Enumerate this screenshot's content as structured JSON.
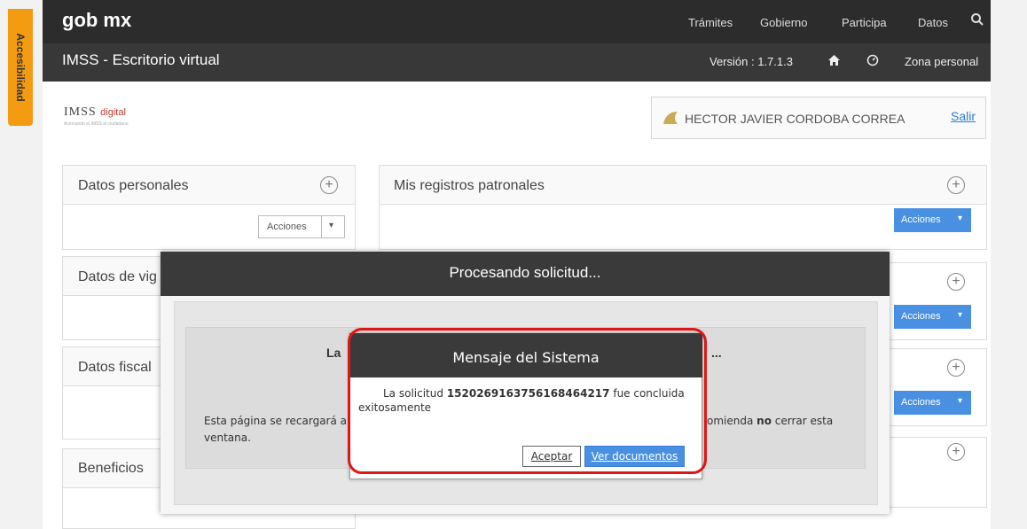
{
  "accessibility_tab": "Accesibilidad",
  "header": {
    "brand": "gob mx",
    "nav": [
      "Trámites",
      "Gobierno",
      "Participa",
      "Datos"
    ]
  },
  "subheader": {
    "title": "IMSS - Escritorio virtual",
    "version": "Versión : 1.7.1.3",
    "zona": "Zona personal"
  },
  "logo": {
    "imss": "IMSS",
    "digital": "digital",
    "tagline": "Acercando el IMSS al ciudadano"
  },
  "user": {
    "name": "HECTOR JAVIER CORDOBA CORREA",
    "logout": "Salir"
  },
  "panels": {
    "datos_personales": "Datos personales",
    "registros": "Mis registros patronales",
    "vigencia": "Datos de vig",
    "fiscales": "Datos fiscal",
    "beneficios": "Beneficios",
    "acciones": "Acciones"
  },
  "processing": {
    "title": "Procesando solicitud...",
    "inner_left": "La",
    "inner_right": "...",
    "text_left_1": "Esta página se recargará a",
    "text_left_2": "ventana.",
    "text_right_pre": "omienda",
    "text_right_bold": "no",
    "text_right_post": "cerrar esta"
  },
  "message": {
    "title": "Mensaje del Sistema",
    "text_pre": "La solicitud",
    "request_id": "15202691637561684642​17",
    "text_post": "fue concluida",
    "text_line2": "exitosamente",
    "accept": "Aceptar",
    "documents": "Ver documentos"
  }
}
